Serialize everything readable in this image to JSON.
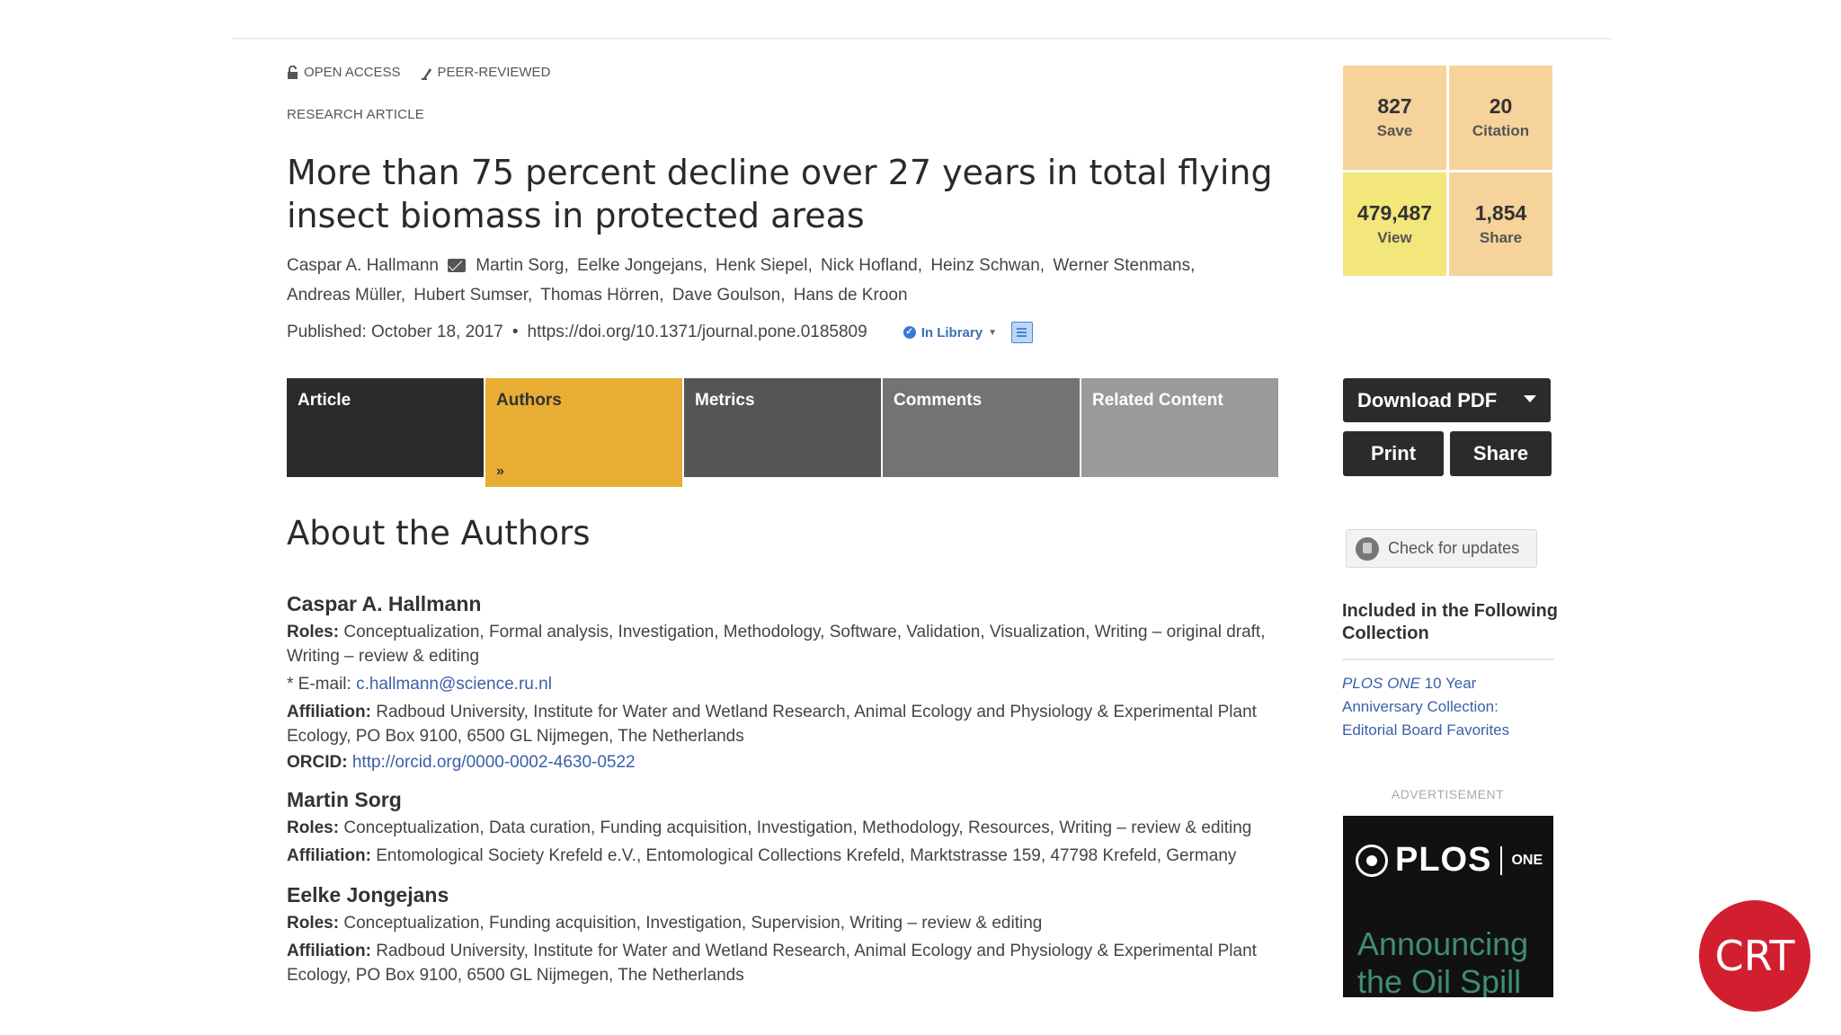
{
  "badges": {
    "open_access": "OPEN ACCESS",
    "peer_reviewed": "PEER-REVIEWED"
  },
  "article_type": "RESEARCH ARTICLE",
  "title": "More than 75 percent decline over 27 years in total flying insect biomass in protected areas",
  "authors": [
    "Caspar A. Hallmann",
    "Martin Sorg,",
    "Eelke Jongejans,",
    "Henk Siepel,",
    "Nick Hofland,",
    "Heinz Schwan,",
    "Werner Stenmans,",
    "Andreas Müller,",
    "Hubert Sumser,",
    "Thomas Hörren,",
    "Dave Goulson,",
    "Hans de Kroon"
  ],
  "published": "Published: October 18, 2017",
  "doi": "https://doi.org/10.1371/journal.pone.0185809",
  "in_library": "In Library",
  "metrics": {
    "save": {
      "value": "827",
      "label": "Save"
    },
    "citation": {
      "value": "20",
      "label": "Citation"
    },
    "view": {
      "value": "479,487",
      "label": "View"
    },
    "share": {
      "value": "1,854",
      "label": "Share"
    }
  },
  "tabs": [
    "Article",
    "Authors",
    "Metrics",
    "Comments",
    "Related Content"
  ],
  "active_tab": "Authors",
  "actions": {
    "download": "Download PDF",
    "print": "Print",
    "share": "Share",
    "check_updates": "Check for updates"
  },
  "collection": {
    "heading": "Included in the Following Collection",
    "link_italic": "PLOS ONE",
    "link_rest": " 10 Year Anniversary Collection: Editorial Board Favorites"
  },
  "ad": {
    "label": "ADVERTISEMENT",
    "brand": "PLOS",
    "brand_sub": "ONE",
    "text": "Announcing the Oil Spill"
  },
  "section_title": "About the Authors",
  "author_details": [
    {
      "name": "Caspar A. Hallmann",
      "roles_label": "Roles:",
      "roles": "Conceptualization, Formal analysis, Investigation, Methodology, Software, Validation, Visualization, Writing – original draft, Writing – review & editing",
      "email_label": "* E-mail:",
      "email": "c.hallmann@science.ru.nl",
      "affiliation_label": "Affiliation:",
      "affiliation": "Radboud University, Institute for Water and Wetland Research, Animal Ecology and Physiology & Experimental Plant Ecology, PO Box 9100, 6500 GL Nijmegen, The Netherlands",
      "orcid_label": "ORCID:",
      "orcid": "http://orcid.org/0000-0002-4630-0522"
    },
    {
      "name": "Martin Sorg",
      "roles_label": "Roles:",
      "roles": "Conceptualization, Data curation, Funding acquisition, Investigation, Methodology, Resources, Writing – review & editing",
      "affiliation_label": "Affiliation:",
      "affiliation": "Entomological Society Krefeld e.V., Entomological Collections Krefeld, Marktstrasse 159, 47798 Krefeld, Germany"
    },
    {
      "name": "Eelke Jongejans",
      "roles_label": "Roles:",
      "roles": "Conceptualization, Funding acquisition, Investigation, Supervision, Writing – review & editing",
      "affiliation_label": "Affiliation:",
      "affiliation": "Radboud University, Institute for Water and Wetland Research, Animal Ecology and Physiology & Experimental Plant Ecology, PO Box 9100, 6500 GL Nijmegen, The Netherlands"
    }
  ],
  "watermark": "CRT"
}
